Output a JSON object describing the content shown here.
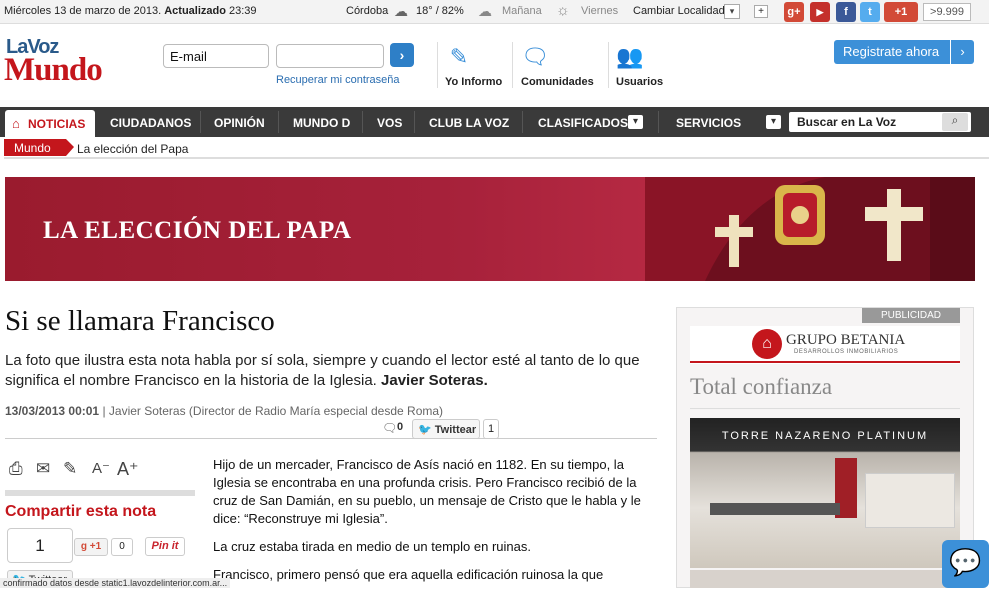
{
  "topbar": {
    "date": "Miércoles 13 de marzo de 2013.",
    "updated_label": "Actualizado",
    "updated_time": "23:39",
    "city": "Córdoba",
    "weather_now": "18° / 82%",
    "tomorrow": "Mañana",
    "friday": "Viernes",
    "change_location": "Cambiar Localidad",
    "plus": "+",
    "gplus_label": "+1",
    "gplus_count": ">9.999"
  },
  "header": {
    "logo_top": "LaVoz",
    "logo_main": "Mundo",
    "email_placeholder": "E-mail",
    "recover_password": "Recuperar mi contraseña",
    "yo_informo": "Yo Informo",
    "comunidades": "Comunidades",
    "usuarios": "Usuarios",
    "register": "Registrate ahora"
  },
  "nav": {
    "items": [
      "NOTICIAS",
      "CIUDADANOS",
      "OPINIÓN",
      "MUNDO D",
      "VOS",
      "CLUB LA VOZ",
      "CLASIFICADOS",
      "SERVICIOS"
    ],
    "search_placeholder": "Buscar en La Voz"
  },
  "breadcrumb": {
    "section": "Mundo",
    "page": "La elección del Papa"
  },
  "banner": {
    "title": "LA ELECCIÓN DEL PAPA"
  },
  "article": {
    "headline": "Si se llamara Francisco",
    "lead": "La foto que ilustra esta nota habla por sí sola, siempre y cuando el lector esté al tanto de lo que significa el nombre Francisco en la historia de la Iglesia.",
    "lead_author": "Javier Soteras.",
    "date": "13/03/2013 00:01",
    "byline": "| Javier Soteras (Director de Radio María especial desde Roma)",
    "comments": "0",
    "tweet_label": "Twittear",
    "tweet_count": "1",
    "paragraphs": [
      "Hijo de un mercader, Francisco de Asís nació en 1182. En su tiempo, la Iglesia se encontraba en una profunda crisis. Pero Francisco recibió de la cruz de San Damián, en su pueblo, un mensaje de Cristo que le habla y le dice: “Reconstruye mi Iglesia”.",
      "La cruz estaba tirada en medio de un templo en ruinas.",
      "Francisco, primero pensó que era aquella edificación ruinosa la que"
    ]
  },
  "share": {
    "title": "Compartir esta nota",
    "like_count": "1",
    "gplus_label": "+1",
    "gplus_count": "0",
    "pinit": "Pin it",
    "twitter_label": "Twittear"
  },
  "ad": {
    "label": "PUBLICIDAD",
    "brand": "GRUPO BETANIA",
    "brand_sub": "DESARROLLOS INMOBILIARIOS",
    "headline": "Total confianza",
    "torre_line": "TORRE NAZARENO PLATINUM"
  },
  "status_bar": "confirmado datos desde static1.lavozdelinterior.com.ar..."
}
